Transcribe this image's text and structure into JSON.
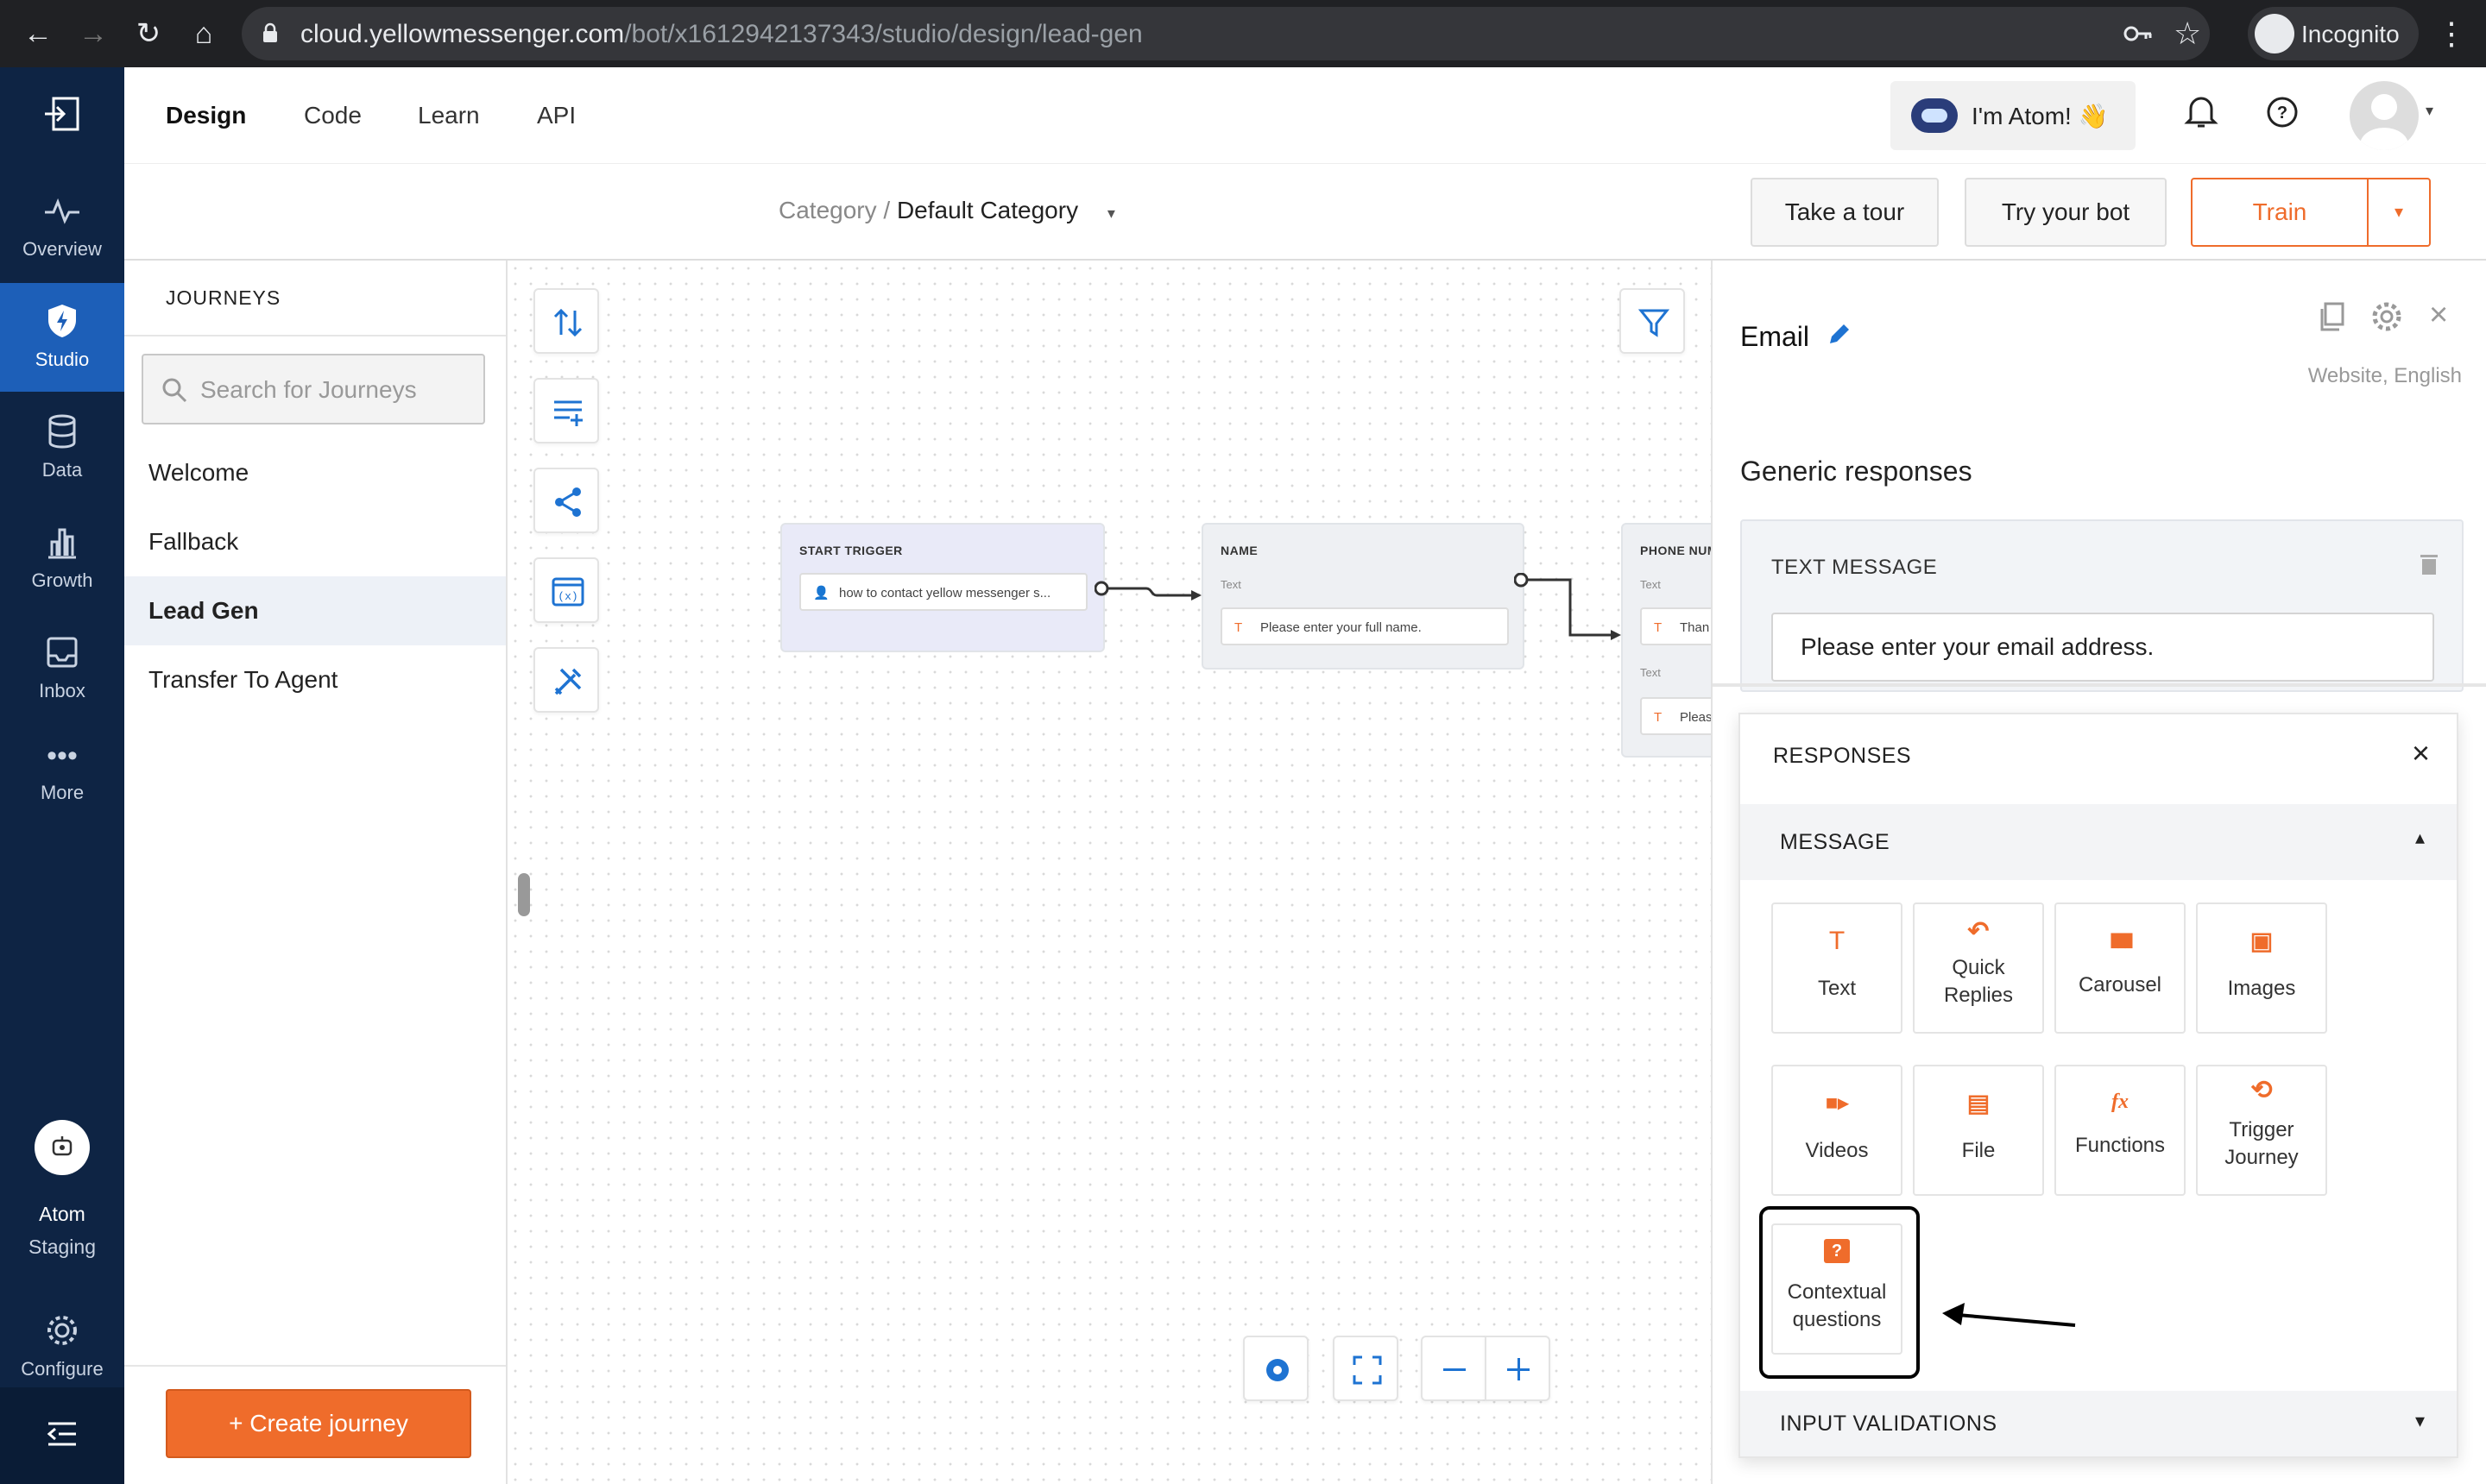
{
  "browser": {
    "url_host": "cloud.yellowmessenger.com",
    "url_path": "/bot/x1612942137343/studio/design/lead-gen",
    "incognito_label": "Incognito"
  },
  "rail": {
    "items": [
      {
        "label": "Overview"
      },
      {
        "label": "Studio"
      },
      {
        "label": "Data"
      },
      {
        "label": "Growth"
      },
      {
        "label": "Inbox"
      },
      {
        "label": "More"
      }
    ],
    "bot_name_1": "Atom",
    "bot_name_2": "Staging",
    "configure": "Configure"
  },
  "topnav": {
    "tabs": [
      "Design",
      "Code",
      "Learn",
      "API"
    ],
    "atom_button": "I'm Atom! 👋"
  },
  "subbar": {
    "category_label": "Category /",
    "category_value": "Default Category",
    "take_tour": "Take a tour",
    "try_bot": "Try your bot",
    "train": "Train"
  },
  "journeys": {
    "heading": "JOURNEYS",
    "search_placeholder": "Search for Journeys",
    "items": [
      "Welcome",
      "Fallback",
      "Lead Gen",
      "Transfer To Agent"
    ],
    "create_button": "+ Create journey"
  },
  "flow": {
    "start": {
      "title": "START TRIGGER",
      "field": "how to contact yellow messenger s..."
    },
    "name": {
      "title": "NAME",
      "sub": "Text",
      "field": "Please enter your full name."
    },
    "phone": {
      "title": "PHONE NUM",
      "sub1": "Text",
      "field1": "Than",
      "sub2": "Text",
      "field2": "Pleas"
    }
  },
  "right_panel": {
    "title": "Email",
    "channel": "Website, English",
    "generic_heading": "Generic responses",
    "text_message_label": "TEXT MESSAGE",
    "text_message_value": "Please enter your email address."
  },
  "responses": {
    "heading": "RESPONSES",
    "message_section": "MESSAGE",
    "tiles": [
      {
        "icon": "text-icon",
        "glyph": "T",
        "label1": "Text",
        "label2": ""
      },
      {
        "icon": "reply-icon",
        "glyph": "↶",
        "label1": "Quick",
        "label2": "Replies"
      },
      {
        "icon": "carousel-icon",
        "glyph": "▮▮▮",
        "label1": "Carousel",
        "label2": ""
      },
      {
        "icon": "image-icon",
        "glyph": "▣",
        "label1": "Images",
        "label2": ""
      },
      {
        "icon": "video-icon",
        "glyph": "■▸",
        "label1": "Videos",
        "label2": ""
      },
      {
        "icon": "file-icon",
        "glyph": "▤",
        "label1": "File",
        "label2": ""
      },
      {
        "icon": "function-icon",
        "glyph": "fx",
        "label1": "Functions",
        "label2": ""
      },
      {
        "icon": "trigger-icon",
        "glyph": "⟲",
        "label1": "Trigger",
        "label2": "Journey"
      },
      {
        "icon": "question-icon",
        "glyph": "?",
        "label1": "Contextual",
        "label2": "questions"
      }
    ],
    "input_validations": "INPUT VALIDATIONS"
  },
  "colors": {
    "accent": "#ef6c2b",
    "rail_bg": "#0e2444",
    "rail_active": "#1d5fb8",
    "link_blue": "#1e73d2"
  }
}
